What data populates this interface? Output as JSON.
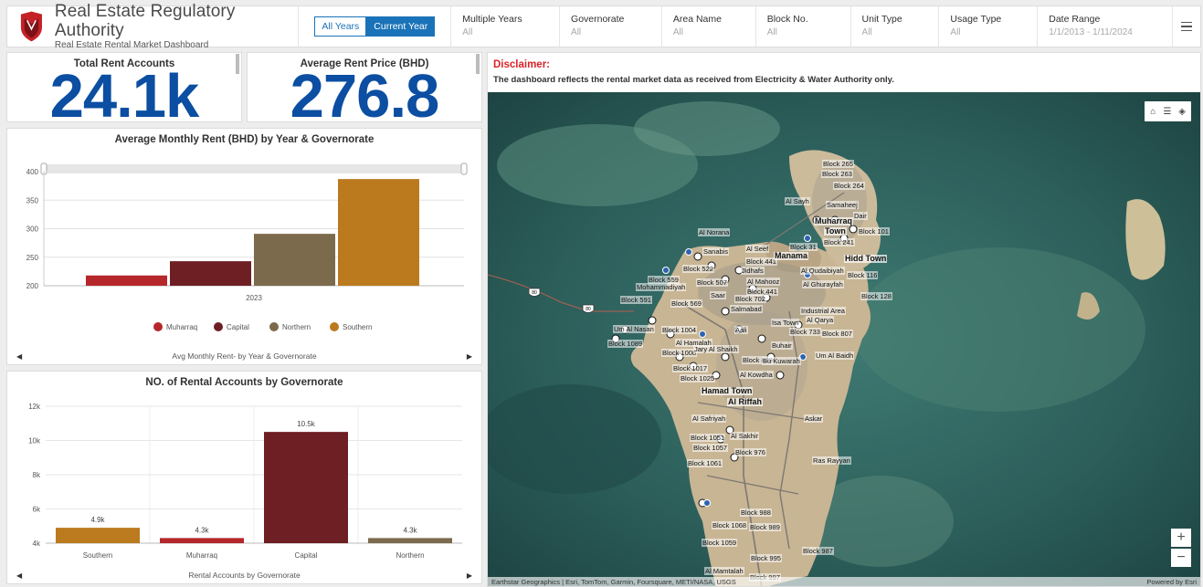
{
  "header": {
    "title": "Real Estate Regulatory Authority",
    "subtitle": "Real Estate Rental Market Dashboard",
    "year_all": "All Years",
    "year_current": "Current Year",
    "menu_icon": "hamburger-menu-icon",
    "filters": [
      {
        "label": "Multiple Years",
        "value": "All"
      },
      {
        "label": "Governorate",
        "value": "All"
      },
      {
        "label": "Area Name",
        "value": "All"
      },
      {
        "label": "Block No.",
        "value": "All"
      },
      {
        "label": "Unit Type",
        "value": "All"
      },
      {
        "label": "Usage Type",
        "value": "All"
      },
      {
        "label": "Date Range",
        "value": "1/1/2013 - 1/11/2024"
      }
    ]
  },
  "kpis": {
    "rent_accounts_title": "Total Rent Accounts",
    "rent_accounts_value": "24.1k",
    "avg_price_title": "Average Rent Price (BHD)",
    "avg_price_value": "276.8"
  },
  "colors": {
    "muharraq": "#b5272b",
    "capital": "#6e1f24",
    "northern": "#7c6a4d",
    "southern": "#bb7a1e",
    "kpi": "#0b4ea2",
    "accent": "#1a73b8"
  },
  "chart_data": [
    {
      "type": "bar",
      "title": "Average Monthly Rent (BHD) by Year & Governorate",
      "footer": "Avg Monthly Rent- by Year & Governorate",
      "categories": [
        "2023"
      ],
      "series": [
        {
          "name": "Muharraq",
          "values": [
            218
          ]
        },
        {
          "name": "Capital",
          "values": [
            243
          ]
        },
        {
          "name": "Northern",
          "values": [
            291
          ]
        },
        {
          "name": "Southern",
          "values": [
            387
          ]
        }
      ],
      "ylim": [
        200,
        400
      ],
      "yticks": [
        "200",
        "250",
        "300",
        "350",
        "400"
      ],
      "legend": "bottom"
    },
    {
      "type": "bar",
      "title": "NO. of Rental Accounts by Governorate",
      "footer": "Rental Accounts by Governorate",
      "categories": [
        "Southern",
        "Muharraq",
        "Capital",
        "Northern"
      ],
      "values": [
        4900,
        4300,
        10500,
        4300
      ],
      "data_labels": [
        "4.9k",
        "4.3k",
        "10.5k",
        "4.3k"
      ],
      "ylim": [
        4000,
        12000
      ],
      "yticks": [
        "4k",
        "6k",
        "8k",
        "10k",
        "12k"
      ]
    }
  ],
  "map": {
    "disclaimer_title": "Disclaimer:",
    "disclaimer_text": "The dashboard reflects the rental market data as received from Electricity & Water Authority only.",
    "attribution": "Earthstar Geographics | Esri, TomTom, Garmin, Foursquare, METI/NASA, USGS",
    "powered": "Powered by Esri",
    "home_icon": "home-icon",
    "legend_icon": "legend-list-icon",
    "layers_icon": "layers-icon",
    "zoom_in": "+",
    "zoom_out": "−",
    "route_shield": "80",
    "labels": {
      "b265": "Block 265",
      "b263": "Block 263",
      "b264": "Block 264",
      "alsayh": "Al Sayh",
      "samaheej": "Samaheej",
      "dair": "Dair",
      "muharraq": "Muharraq",
      "town": "Town",
      "b241": "Block 241",
      "b101": "Block 101",
      "alnorana": "Al Norana",
      "alseef": "Al Seef",
      "b31": "Block 31",
      "sanabis": "Sanabis",
      "b441": "Block 441",
      "manama": "Manama",
      "hiddtown": "Hidd Town",
      "b522": "Block 522",
      "jidhafs": "Jidhafs",
      "alqudaibiya": "Al Qudaibiyah",
      "b116": "Block 116",
      "mohammadiyah": "Mohammadiyah",
      "b559": "Block 559",
      "b507": "Block 507",
      "almahooz": "Al Mahooz",
      "b441b": "Block 441",
      "algurayfah": "Al Ghurayfah",
      "b128": "Block 128",
      "saar": "Saar",
      "b591": "Block 591",
      "b569": "Block 569",
      "b702": "Block 702",
      "industrial": "Industrial Area",
      "salmabad": "Salmabad",
      "alqarya": "Al Qarya",
      "isatown": "Isa Town",
      "b733": "Block 733",
      "b807": "Block 807",
      "umalnasan": "Um Al Nasan",
      "b1004": "Block 1004",
      "aali": "Aali",
      "alhamalah": "Al Hamalah",
      "buhair": "Buhair",
      "b1089": "Block 1089",
      "b1008": "Block 1008",
      "jaryalshaikh": "Jary Al Shaikh",
      "b828": "Block 828",
      "umalbaidh": "Um Al Baidh",
      "bukuwarah": "Bu Kuwarah",
      "b1017": "Block 1017",
      "b1025": "Block 1025",
      "alkowdha": "Al Kowdha",
      "hamadtown": "Hamad Town",
      "alriffah": "Al Riffah",
      "askar": "Askar",
      "alsafriyah": "Al Safriyah",
      "b1051": "Block 1051",
      "alsakhir": "Al Sakhir",
      "b1057": "Block 1057",
      "b976": "Block 976",
      "b1061": "Block 1061",
      "rasrayyan": "Ras Rayyan",
      "b988": "Block 988",
      "b1068": "Block 1068",
      "b989": "Block 989",
      "b1059": "Block 1059",
      "b995": "Block 995",
      "b987": "Block 987",
      "almamlah": "Al Mamtalah",
      "b997": "Block 997"
    }
  }
}
